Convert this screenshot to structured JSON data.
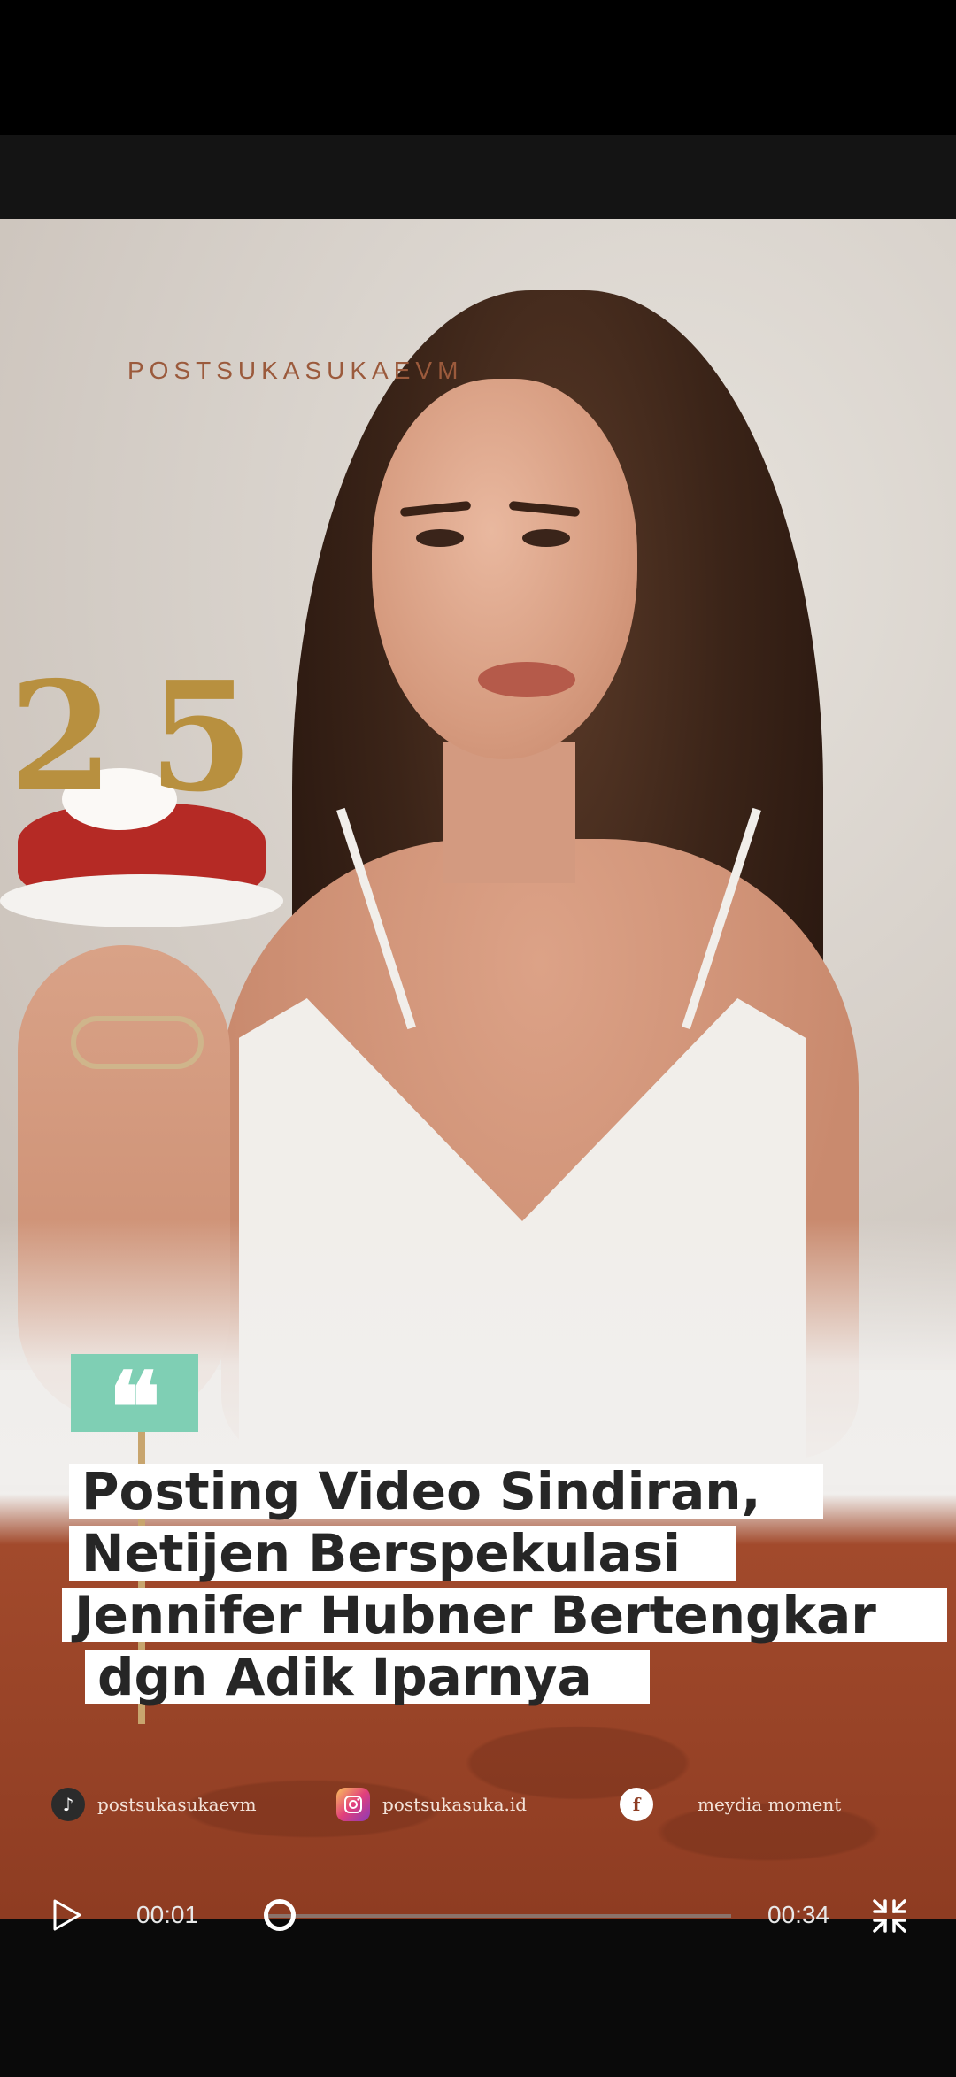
{
  "overlay": {
    "watermark": "POSTSUKASUKAEVM",
    "headline_lines": [
      "Posting Video Sindiran,",
      "Netijen Berspekulasi",
      "Jennifer Hubner Bertengkar",
      "dgn Adik Iparnya"
    ],
    "candle_digits": [
      "2",
      "5"
    ],
    "quote_glyph": "❝",
    "socials": [
      {
        "icon": "tiktok-icon",
        "label": "postsukasukaevm"
      },
      {
        "icon": "instagram-icon",
        "label": "postsukasuka.id"
      },
      {
        "icon": "facebook-icon",
        "label": "meydia moment"
      }
    ]
  },
  "player": {
    "current_time": "00:01",
    "duration": "00:34",
    "progress": 0.03
  },
  "colors": {
    "quote_accent": "#7fcfb4",
    "bottom_panel": "#8e3c22"
  }
}
